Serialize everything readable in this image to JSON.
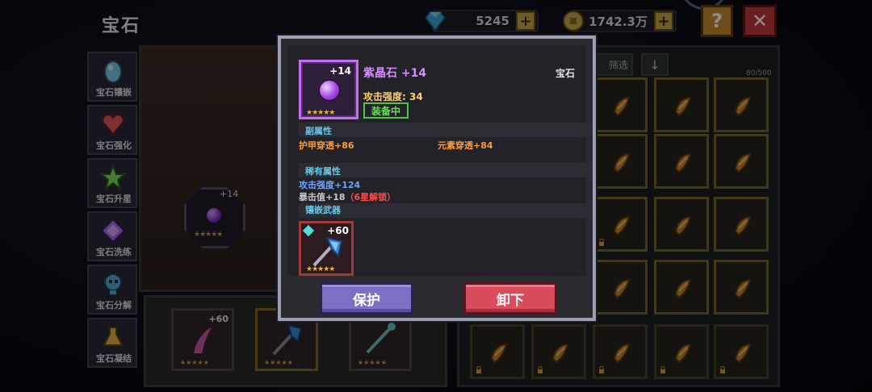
{
  "header": {
    "title": "宝石",
    "gem_currency": "5245",
    "gold_currency": "1742.3万",
    "plus_symbol": "+",
    "help_symbol": "?",
    "close_symbol": "✕"
  },
  "sidebar": {
    "items": [
      {
        "label": "宝石镶嵌",
        "icon": "egg-gem-icon",
        "color": "#7fc9e6"
      },
      {
        "label": "宝石强化",
        "icon": "heart-gem-icon",
        "color": "#e05a5a"
      },
      {
        "label": "宝石升星",
        "icon": "star-icon",
        "color": "#7be06a"
      },
      {
        "label": "宝石洗练",
        "icon": "purple-diamond-icon",
        "color": "#a46ee6"
      },
      {
        "label": "宝石分解",
        "icon": "skull-hammer-icon",
        "color": "#5aaed0"
      },
      {
        "label": "宝石凝结",
        "icon": "gold-flask-icon",
        "color": "#e0b441"
      }
    ]
  },
  "center": {
    "slot_plus": "+14",
    "slot_stars": "★★★★★",
    "tray": [
      {
        "plus": "+60",
        "stars": "★★★★★"
      },
      {
        "plus": "",
        "stars": "★★★★★"
      },
      {
        "plus": "",
        "stars": "★★★★★"
      }
    ]
  },
  "right_panel": {
    "filter_label": "筛选",
    "sort_symbol": "↓",
    "count": "80/500"
  },
  "modal": {
    "gem_plus": "+14",
    "gem_name": "紫晶石 +14",
    "gem_type": "宝石",
    "gem_stars": "★★★★★",
    "attack": "攻击强度: 34",
    "equipped_badge": "装备中",
    "secondary_title": "副属性",
    "secondary_attrs": [
      "护甲穿透+86",
      "元素穿透+84"
    ],
    "rare_title": "稀有属性",
    "rare_attr_1": "攻击强度+124",
    "rare_attr_2": "暴击值+18",
    "rare_attr_2_lock": "（6星解锁）",
    "inlay_title": "镶嵌武器",
    "weapon_plus": "+60",
    "weapon_stars": "★★★★★",
    "protect_button": "保护",
    "unequip_button": "卸下"
  },
  "colors": {
    "gem_name": "#d68cff",
    "attack": "#ffd16b",
    "equipped": "#6fdc5f",
    "section_title": "#63c7e6",
    "secondary_attr": "#ff9c3a",
    "rare_attr": "#6aa6ff",
    "locked_note": "#ff4b4b",
    "protect_button": "#7c6fc6",
    "unequip_button": "#d94c5c"
  }
}
